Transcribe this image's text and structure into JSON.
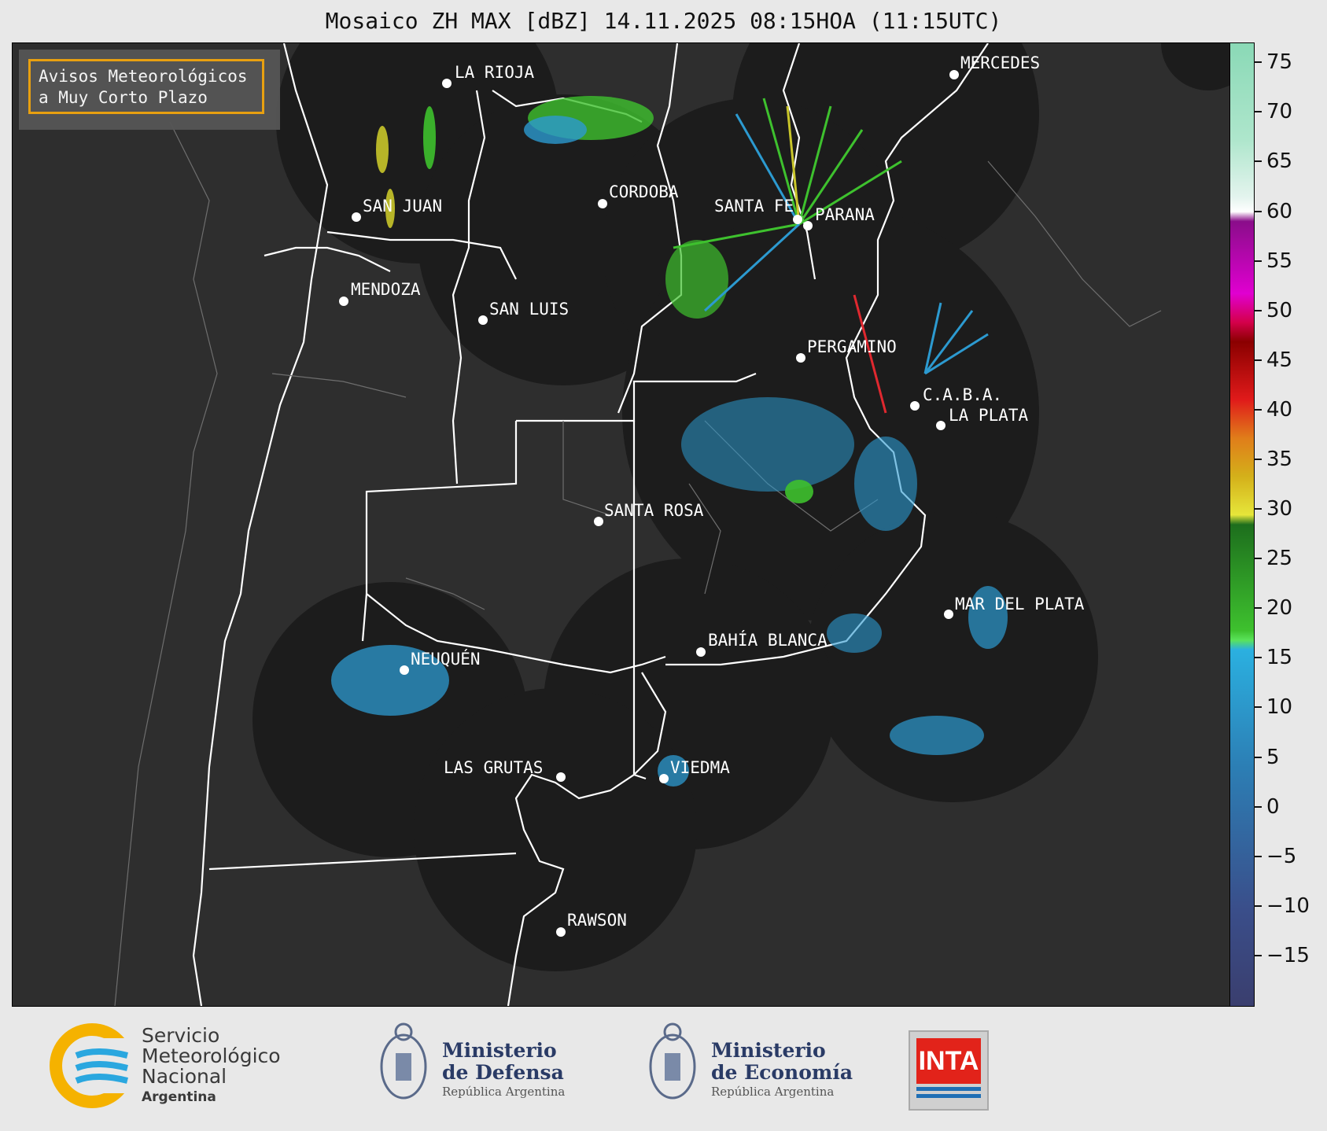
{
  "title": "Mosaico ZH MAX [dBZ] 14.11.2025 08:15HOA (11:15UTC)",
  "notice": {
    "line1": "Avisos Meteorológicos",
    "line2": "a Muy Corto Plazo"
  },
  "cities": [
    {
      "name": "LA RIOJA"
    },
    {
      "name": "MERCEDES"
    },
    {
      "name": "SAN JUAN"
    },
    {
      "name": "CORDOBA"
    },
    {
      "name": "SANTA FE"
    },
    {
      "name": "PARANA"
    },
    {
      "name": "MENDOZA"
    },
    {
      "name": "SAN LUIS"
    },
    {
      "name": "PERGAMINO"
    },
    {
      "name": "C.A.B.A."
    },
    {
      "name": "LA PLATA"
    },
    {
      "name": "SANTA ROSA"
    },
    {
      "name": "MAR DEL PLATA"
    },
    {
      "name": "NEUQUÉN"
    },
    {
      "name": "BAHÍA BLANCA"
    },
    {
      "name": "LAS GRUTAS"
    },
    {
      "name": "VIEDMA"
    },
    {
      "name": "RAWSON"
    }
  ],
  "colorbar": {
    "unit": "dBZ",
    "min": -20,
    "max": 77,
    "ticks": [
      "75",
      "70",
      "65",
      "60",
      "55",
      "50",
      "45",
      "40",
      "35",
      "30",
      "25",
      "20",
      "15",
      "10",
      "5",
      "0",
      "−5",
      "−10",
      "−15"
    ],
    "tick_values": [
      75,
      70,
      65,
      60,
      55,
      50,
      45,
      40,
      35,
      30,
      25,
      20,
      15,
      10,
      5,
      0,
      -5,
      -10,
      -15
    ]
  },
  "logos": {
    "smn": {
      "line1": "Servicio",
      "line2": "Meteorológico",
      "line3": "Nacional",
      "line4": "Argentina"
    },
    "defensa": {
      "line1": "Ministerio",
      "line2": "de Defensa",
      "line3": "República Argentina"
    },
    "economia": {
      "line1": "Ministerio",
      "line2": "de Economía",
      "line3": "República Argentina"
    },
    "inta": {
      "text": "INTA"
    }
  },
  "colors": {
    "radar_disk": "#1c1c1c",
    "background": "#2e2e2e",
    "border_line": "#ffffff",
    "notice_border": "#f2a70f"
  }
}
